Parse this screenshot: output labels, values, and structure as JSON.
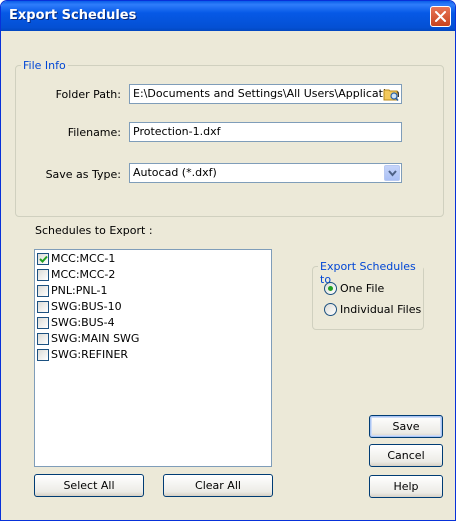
{
  "window": {
    "title": "Export Schedules"
  },
  "file_info": {
    "legend": "File Info",
    "folder_path_label": "Folder Path:",
    "folder_path_value": "E:\\Documents and Settings\\All Users\\Application D",
    "filename_label": "Filename:",
    "filename_value": "Protection-1.dxf",
    "save_as_type_label": "Save as Type:",
    "save_as_type_value": "Autocad (*.dxf)"
  },
  "schedules": {
    "label": "Schedules to Export :",
    "items": [
      {
        "label": "MCC:MCC-1",
        "checked": true
      },
      {
        "label": "MCC:MCC-2",
        "checked": false
      },
      {
        "label": "PNL:PNL-1",
        "checked": false
      },
      {
        "label": "SWG:BUS-10",
        "checked": false
      },
      {
        "label": "SWG:BUS-4",
        "checked": false
      },
      {
        "label": "SWG:MAIN SWG",
        "checked": false
      },
      {
        "label": "SWG:REFINER",
        "checked": false
      }
    ],
    "select_all_label": "Select All",
    "clear_all_label": "Clear All"
  },
  "export_to": {
    "legend": "Export Schedules to",
    "options": [
      {
        "label": "One File",
        "selected": true
      },
      {
        "label": "Individual Files",
        "selected": false
      }
    ]
  },
  "buttons": {
    "save": "Save",
    "cancel": "Cancel",
    "help": "Help"
  },
  "colors": {
    "title_bar": "#0450d4",
    "legend_text": "#0046d5",
    "dialog_bg": "#ece9d8",
    "close_button": "#c8431d"
  }
}
